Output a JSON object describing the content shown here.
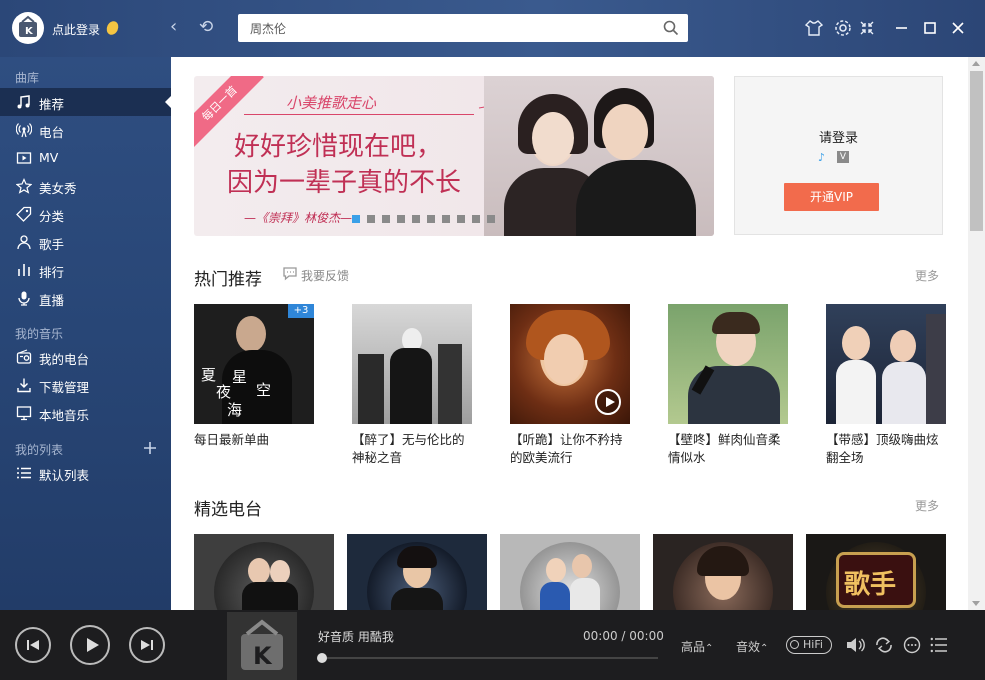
{
  "header": {
    "login_text": "点此登录",
    "search_value": "周杰伦"
  },
  "sidebar": {
    "library_title": "曲库",
    "library_items": [
      {
        "label": "推荐"
      },
      {
        "label": "电台"
      },
      {
        "label": "MV"
      },
      {
        "label": "美女秀"
      },
      {
        "label": "分类"
      },
      {
        "label": "歌手"
      },
      {
        "label": "排行"
      },
      {
        "label": "直播"
      }
    ],
    "my_music_title": "我的音乐",
    "my_music_items": [
      {
        "label": "我的电台"
      },
      {
        "label": "下载管理"
      },
      {
        "label": "本地音乐"
      }
    ],
    "my_lists_title": "我的列表",
    "my_lists_items": [
      {
        "label": "默认列表"
      }
    ]
  },
  "banner": {
    "badge": "每日一首",
    "script_title": "小美推歌走心",
    "line1": "好好珍惜现在吧，",
    "line2": "因为一辈子真的不长",
    "source": "—《崇拜》林俊杰—",
    "dots": 10,
    "active_dot": 0
  },
  "login_box": {
    "title": "请登录",
    "vip_button": "开通VIP"
  },
  "hot": {
    "title": "热门推荐",
    "feedback": "我要反馈",
    "more": "更多",
    "cards": [
      {
        "title": "每日最新单曲",
        "badge": "+3",
        "cover_text1": "夏",
        "cover_text2": "夜",
        "cover_text3": "星",
        "cover_text4": "空",
        "cover_text5": "海"
      },
      {
        "title": "【醉了】无与伦比的神秘之音"
      },
      {
        "title": "【听跪】让你不矜持的欧美流行"
      },
      {
        "title": "【壁咚】鲜肉仙音柔情似水"
      },
      {
        "title": "【带感】顶级嗨曲炫翻全场"
      }
    ]
  },
  "radio": {
    "title": "精选电台",
    "more": "更多",
    "stations": [
      {
        "id": 1
      },
      {
        "id": 2
      },
      {
        "id": 3
      },
      {
        "id": 4
      },
      {
        "id": 5
      }
    ],
    "logo_text": "歌手"
  },
  "player": {
    "track": "好音质 用酷我",
    "time": "00:00 / 00:00",
    "quality": "高品",
    "effect": "音效",
    "hifi": "HiFi",
    "progress": 0
  },
  "colors": {
    "vip": "#f26b4c",
    "accent": "#3ba0e8",
    "sidebar": "#284676",
    "player": "#1d1d1f"
  }
}
